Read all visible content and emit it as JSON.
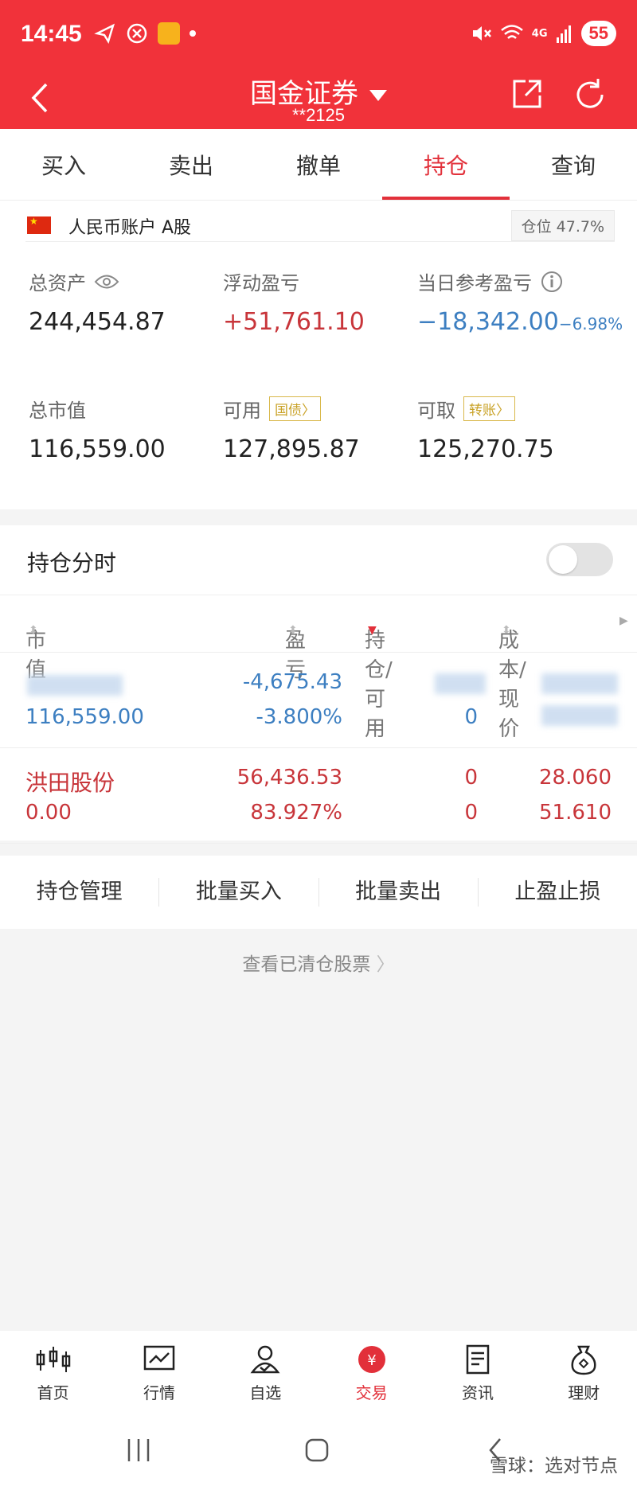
{
  "status_bar": {
    "time": "14:45",
    "network": "4G",
    "battery": "55"
  },
  "nav": {
    "title": "国金证券",
    "account_masked": "**2125"
  },
  "tabs": [
    {
      "label": "买入"
    },
    {
      "label": "卖出"
    },
    {
      "label": "撤单"
    },
    {
      "label": "持仓",
      "active": true
    },
    {
      "label": "查询"
    }
  ],
  "account": {
    "label": "人民币账户 A股",
    "position_label": "仓位",
    "position_pct": "47.7%",
    "total_assets_label": "总资产",
    "total_assets": "244,454.87",
    "floating_pl_label": "浮动盈亏",
    "floating_pl": "+51,761.10",
    "day_pl_label": "当日参考盈亏",
    "day_pl": "−18,342.00",
    "day_pl_pct": "−6.98%",
    "market_value_label": "总市值",
    "market_value": "116,559.00",
    "available_label": "可用",
    "available_tag": "国债",
    "available": "127,895.87",
    "withdrawable_label": "可取",
    "withdrawable_tag": "转账",
    "withdrawable": "125,270.75"
  },
  "holdings": {
    "timeline_label": "持仓分时",
    "headers": {
      "market_value": "市值",
      "pl": "盈亏",
      "hold_avail": "持仓/可用",
      "cost_price": "成本/现价"
    },
    "rows": [
      {
        "name": "",
        "market_value": "116,559.00",
        "pl": "-4,675.43",
        "pl_pct": "-3.800%",
        "hold": "",
        "avail": "0",
        "cost": "",
        "price": ""
      },
      {
        "name": "洪田股份",
        "market_value": "0.00",
        "pl": "56,436.53",
        "pl_pct": "83.927%",
        "hold": "0",
        "avail": "0",
        "cost": "28.060",
        "price": "51.610"
      }
    ]
  },
  "actions": [
    {
      "label": "持仓管理"
    },
    {
      "label": "批量买入"
    },
    {
      "label": "批量卖出"
    },
    {
      "label": "止盈止损"
    }
  ],
  "cleared_link": "查看已清仓股票",
  "bottom_nav": [
    {
      "label": "首页",
      "icon": "candlestick-icon"
    },
    {
      "label": "行情",
      "icon": "chart-icon"
    },
    {
      "label": "自选",
      "icon": "user-check-icon"
    },
    {
      "label": "交易",
      "icon": "yuan-icon",
      "active": true
    },
    {
      "label": "资讯",
      "icon": "document-icon"
    },
    {
      "label": "理财",
      "icon": "money-bag-icon"
    }
  ],
  "watermark": "雪球：选对节点",
  "colors": {
    "brand_red": "#f1323a",
    "gain_red": "#c8353a",
    "loss_blue": "#3d7fc1",
    "tag_gold": "#c9a227"
  }
}
